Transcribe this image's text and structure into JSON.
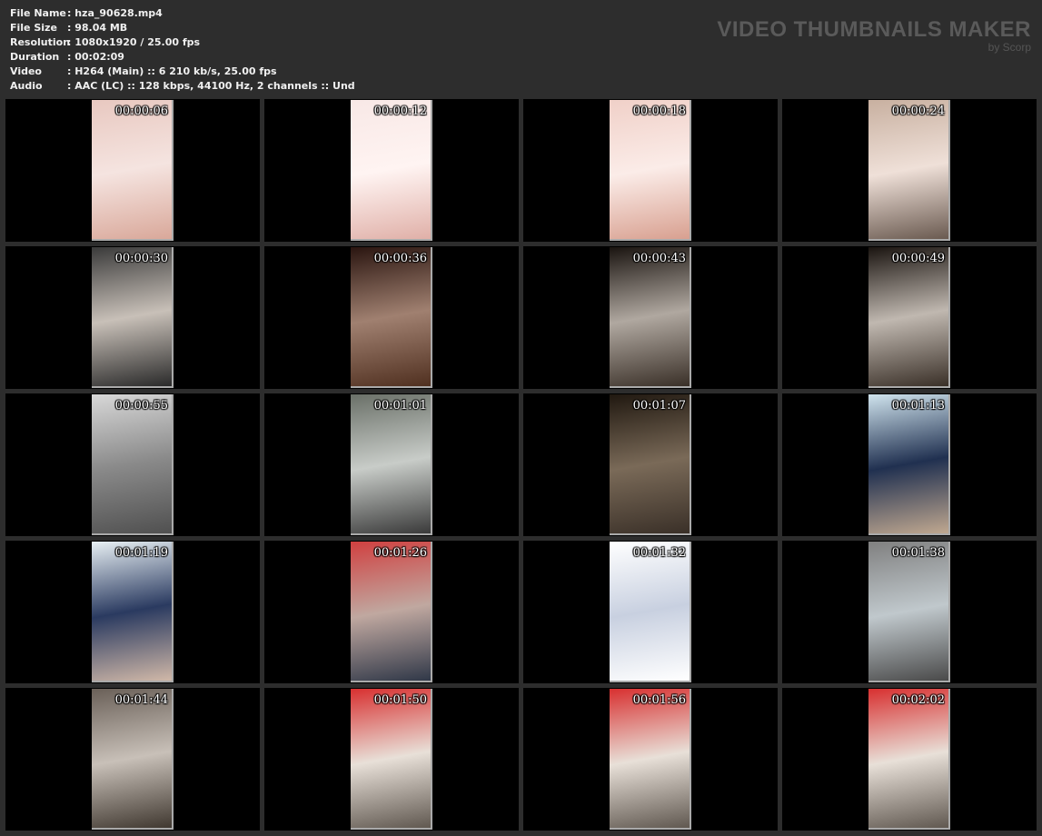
{
  "info": [
    {
      "label": "File Name",
      "value": ": hza_90628.mp4"
    },
    {
      "label": "File Size",
      "value": ": 98.04 MB"
    },
    {
      "label": "Resolution",
      "value": ": 1080x1920 / 25.00 fps"
    },
    {
      "label": "Duration",
      "value": ": 00:02:09"
    },
    {
      "label": "Video",
      "value": ": H264 (Main) :: 6 210 kb/s, 25.00 fps"
    },
    {
      "label": "Audio",
      "value": ": AAC (LC) :: 128 kbps, 44100 Hz, 2 channels :: Und"
    }
  ],
  "brand": {
    "title": "VIDEO THUMBNAILS MAKER",
    "subtitle": "by Scorp"
  },
  "thumbnails": [
    {
      "time": "00:00:06",
      "colors": [
        "#e8c8c0",
        "#f5e4e0",
        "#d9a89a"
      ]
    },
    {
      "time": "00:00:12",
      "colors": [
        "#f8e8e6",
        "#fff4f2",
        "#e0b0a8"
      ]
    },
    {
      "time": "00:00:18",
      "colors": [
        "#f0d0c8",
        "#fbece8",
        "#d8a090"
      ]
    },
    {
      "time": "00:00:24",
      "colors": [
        "#c8b0a0",
        "#efe0d8",
        "#6a5a50"
      ]
    },
    {
      "time": "00:00:30",
      "colors": [
        "#3a3a3a",
        "#c8c0b8",
        "#2a2a2a"
      ]
    },
    {
      "time": "00:00:36",
      "colors": [
        "#2a1510",
        "#a08070",
        "#503020"
      ]
    },
    {
      "time": "00:00:43",
      "colors": [
        "#1a1410",
        "#b0a8a0",
        "#3a3028"
      ]
    },
    {
      "time": "00:00:49",
      "colors": [
        "#1a1410",
        "#c0b8b0",
        "#3a3028"
      ]
    },
    {
      "time": "00:00:55",
      "colors": [
        "#d8d8d8",
        "#8a8a8a",
        "#505050"
      ]
    },
    {
      "time": "00:01:01",
      "colors": [
        "#6a7068",
        "#c8ccc8",
        "#3a3a3a"
      ]
    },
    {
      "time": "00:01:07",
      "colors": [
        "#201810",
        "#7a6a58",
        "#3a3028"
      ]
    },
    {
      "time": "00:01:13",
      "colors": [
        "#d0e4ee",
        "#203050",
        "#c0a890"
      ]
    },
    {
      "time": "00:01:19",
      "colors": [
        "#e8f0f4",
        "#2a3a60",
        "#d0b8a8"
      ]
    },
    {
      "time": "00:01:26",
      "colors": [
        "#d04040",
        "#c0a8a0",
        "#303848"
      ]
    },
    {
      "time": "00:01:32",
      "colors": [
        "#ffffff",
        "#c8d0e0",
        "#ffffff"
      ]
    },
    {
      "time": "00:01:38",
      "colors": [
        "#808080",
        "#c0c8cc",
        "#4a4a4a"
      ]
    },
    {
      "time": "00:01:44",
      "colors": [
        "#6a6058",
        "#c8c0b8",
        "#403830"
      ]
    },
    {
      "time": "00:01:50",
      "colors": [
        "#d83030",
        "#e8e0d8",
        "#605850"
      ]
    },
    {
      "time": "00:01:56",
      "colors": [
        "#d83030",
        "#e8e0d8",
        "#605850"
      ]
    },
    {
      "time": "00:02:02",
      "colors": [
        "#d83030",
        "#e8e0d8",
        "#605850"
      ]
    }
  ]
}
